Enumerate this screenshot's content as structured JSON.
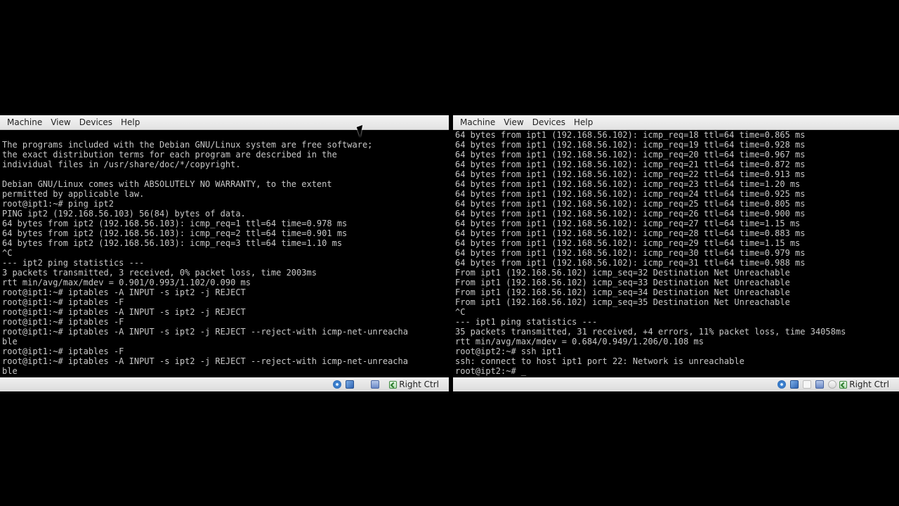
{
  "vm_left": {
    "menu": [
      "Machine",
      "View",
      "Devices",
      "Help"
    ],
    "lines": [
      "The programs included with the Debian GNU/Linux system are free software;",
      "the exact distribution terms for each program are described in the",
      "individual files in /usr/share/doc/*/copyright.",
      "",
      "Debian GNU/Linux comes with ABSOLUTELY NO WARRANTY, to the extent",
      "permitted by applicable law.",
      "root@ipt1:~# ping ipt2",
      "PING ipt2 (192.168.56.103) 56(84) bytes of data.",
      "64 bytes from ipt2 (192.168.56.103): icmp_req=1 ttl=64 time=0.978 ms",
      "64 bytes from ipt2 (192.168.56.103): icmp_req=2 ttl=64 time=0.901 ms",
      "64 bytes from ipt2 (192.168.56.103): icmp_req=3 ttl=64 time=1.10 ms",
      "^C",
      "--- ipt2 ping statistics ---",
      "3 packets transmitted, 3 received, 0% packet loss, time 2003ms",
      "rtt min/avg/max/mdev = 0.901/0.993/1.102/0.090 ms",
      "root@ipt1:~# iptables -A INPUT -s ipt2 -j REJECT",
      "root@ipt1:~# iptables -F",
      "root@ipt1:~# iptables -A INPUT -s ipt2 -j REJECT",
      "root@ipt1:~# iptables -F",
      "root@ipt1:~# iptables -A INPUT -s ipt2 -j REJECT --reject-with icmp-net-unreacha",
      "ble",
      "root@ipt1:~# iptables -F",
      "root@ipt1:~# iptables -A INPUT -s ipt2 -j REJECT --reject-with icmp-net-unreacha",
      "ble"
    ],
    "host_key": "Right Ctrl"
  },
  "vm_right": {
    "menu": [
      "Machine",
      "View",
      "Devices",
      "Help"
    ],
    "lines": [
      "64 bytes from ipt1 (192.168.56.102): icmp_req=18 ttl=64 time=0.865 ms",
      "64 bytes from ipt1 (192.168.56.102): icmp_req=19 ttl=64 time=0.928 ms",
      "64 bytes from ipt1 (192.168.56.102): icmp_req=20 ttl=64 time=0.967 ms",
      "64 bytes from ipt1 (192.168.56.102): icmp_req=21 ttl=64 time=0.872 ms",
      "64 bytes from ipt1 (192.168.56.102): icmp_req=22 ttl=64 time=0.913 ms",
      "64 bytes from ipt1 (192.168.56.102): icmp_req=23 ttl=64 time=1.20 ms",
      "64 bytes from ipt1 (192.168.56.102): icmp_req=24 ttl=64 time=0.925 ms",
      "64 bytes from ipt1 (192.168.56.102): icmp_req=25 ttl=64 time=0.805 ms",
      "64 bytes from ipt1 (192.168.56.102): icmp_req=26 ttl=64 time=0.900 ms",
      "64 bytes from ipt1 (192.168.56.102): icmp_req=27 ttl=64 time=1.15 ms",
      "64 bytes from ipt1 (192.168.56.102): icmp_req=28 ttl=64 time=0.883 ms",
      "64 bytes from ipt1 (192.168.56.102): icmp_req=29 ttl=64 time=1.15 ms",
      "64 bytes from ipt1 (192.168.56.102): icmp_req=30 ttl=64 time=0.979 ms",
      "64 bytes from ipt1 (192.168.56.102): icmp_req=31 ttl=64 time=0.988 ms",
      "From ipt1 (192.168.56.102) icmp_seq=32 Destination Net Unreachable",
      "From ipt1 (192.168.56.102) icmp_seq=33 Destination Net Unreachable",
      "From ipt1 (192.168.56.102) icmp_seq=34 Destination Net Unreachable",
      "From ipt1 (192.168.56.102) icmp_seq=35 Destination Net Unreachable",
      "^C",
      "--- ipt1 ping statistics ---",
      "35 packets transmitted, 31 received, +4 errors, 11% packet loss, time 34058ms",
      "rtt min/avg/max/mdev = 0.684/0.949/1.206/0.108 ms",
      "root@ipt2:~# ssh ipt1",
      "ssh: connect to host ipt1 port 22: Network is unreachable",
      "root@ipt2:~# _"
    ],
    "host_key": "Right Ctrl"
  },
  "colors": {
    "background": "#000000",
    "terminal_text": "#c8c8c8",
    "chrome": "#ececec"
  }
}
